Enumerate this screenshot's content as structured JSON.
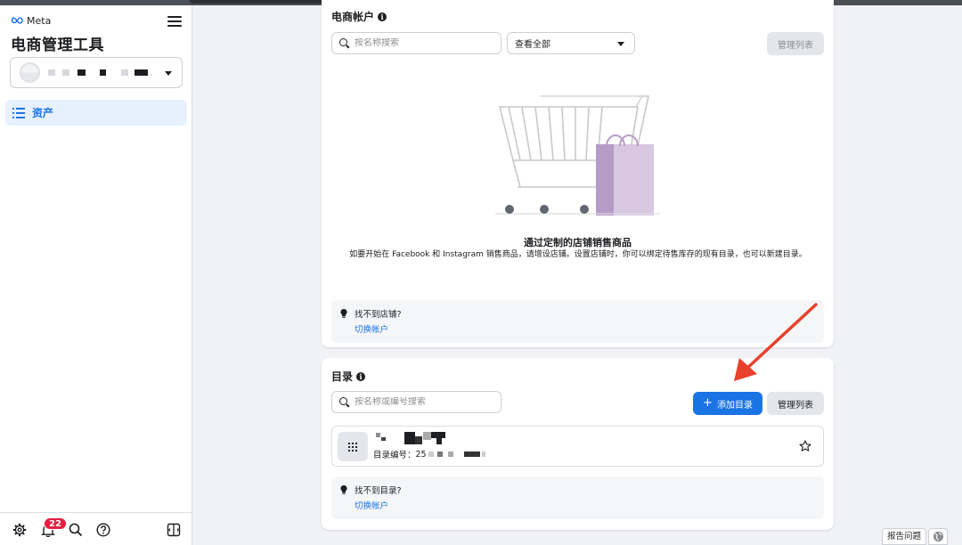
{
  "brand": {
    "logo_text": "Meta",
    "app_title": "电商管理工具"
  },
  "sidebar": {
    "nav_items": [
      {
        "label": "资产",
        "icon": "list-icon",
        "active": true
      }
    ],
    "bottom": {
      "notification_count": "22"
    }
  },
  "commerce_accounts": {
    "title": "电商帐户",
    "search_placeholder": "按名称搜索",
    "filter_value": "查看全部",
    "manage_button": "管理列表",
    "empty_title": "通过定制的店铺销售商品",
    "empty_description": "如要开始在 Facebook 和 Instagram 销售商品，请增设店铺。设置店铺时，你可以绑定待售库存的现有目录，也可以新建目录。",
    "tip": {
      "title": "找不到店铺?",
      "link": "切换帐户"
    }
  },
  "catalogs": {
    "title": "目录",
    "search_placeholder": "按名称或编号搜索",
    "add_button": "添加目录",
    "manage_button": "管理列表",
    "items": [
      {
        "id_label": "目录编号：",
        "id_prefix": "25"
      }
    ],
    "tip": {
      "title": "找不到目录?",
      "link": "切换帐户"
    }
  },
  "footer": {
    "report_button": "报告问题"
  },
  "colors": {
    "accent": "#1b74e4",
    "badge": "#e41e3f",
    "annotation_arrow": "#e8412c"
  }
}
